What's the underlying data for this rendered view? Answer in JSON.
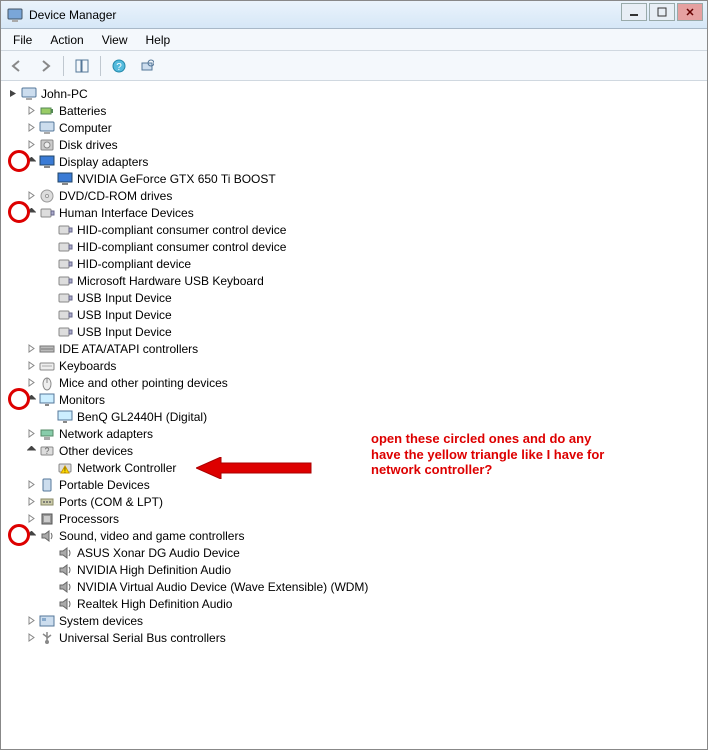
{
  "window": {
    "title": "Device Manager"
  },
  "menus": {
    "file": "File",
    "action": "Action",
    "view": "View",
    "help": "Help"
  },
  "root": {
    "name": "John-PC"
  },
  "tree": [
    {
      "label": "Batteries",
      "icon": "battery",
      "expand": "closed",
      "lv": 1
    },
    {
      "label": "Computer",
      "icon": "computer",
      "expand": "closed",
      "lv": 1
    },
    {
      "label": "Disk drives",
      "icon": "disk",
      "expand": "closed",
      "lv": 1
    },
    {
      "label": "Display adapters",
      "icon": "display",
      "expand": "open",
      "lv": 1,
      "circle": true
    },
    {
      "label": "NVIDIA GeForce GTX 650 Ti BOOST",
      "icon": "display",
      "expand": "none",
      "lv": 2
    },
    {
      "label": "DVD/CD-ROM drives",
      "icon": "dvd",
      "expand": "closed",
      "lv": 1
    },
    {
      "label": "Human Interface Devices",
      "icon": "hid",
      "expand": "open",
      "lv": 1,
      "circle": true
    },
    {
      "label": "HID-compliant consumer control device",
      "icon": "hid",
      "expand": "none",
      "lv": 2
    },
    {
      "label": "HID-compliant consumer control device",
      "icon": "hid",
      "expand": "none",
      "lv": 2
    },
    {
      "label": "HID-compliant device",
      "icon": "hid",
      "expand": "none",
      "lv": 2
    },
    {
      "label": "Microsoft Hardware USB Keyboard",
      "icon": "hid",
      "expand": "none",
      "lv": 2
    },
    {
      "label": "USB Input Device",
      "icon": "hid",
      "expand": "none",
      "lv": 2
    },
    {
      "label": "USB Input Device",
      "icon": "hid",
      "expand": "none",
      "lv": 2
    },
    {
      "label": "USB Input Device",
      "icon": "hid",
      "expand": "none",
      "lv": 2
    },
    {
      "label": "IDE ATA/ATAPI controllers",
      "icon": "ide",
      "expand": "closed",
      "lv": 1
    },
    {
      "label": "Keyboards",
      "icon": "keyboard",
      "expand": "closed",
      "lv": 1
    },
    {
      "label": "Mice and other pointing devices",
      "icon": "mouse",
      "expand": "closed",
      "lv": 1
    },
    {
      "label": "Monitors",
      "icon": "monitor",
      "expand": "open",
      "lv": 1,
      "circle": true
    },
    {
      "label": "BenQ GL2440H (Digital)",
      "icon": "monitor",
      "expand": "none",
      "lv": 2
    },
    {
      "label": "Network adapters",
      "icon": "network",
      "expand": "closed",
      "lv": 1
    },
    {
      "label": "Other devices",
      "icon": "other",
      "expand": "open",
      "lv": 1
    },
    {
      "label": "Network Controller",
      "icon": "warn",
      "expand": "none",
      "lv": 2,
      "arrowto": true
    },
    {
      "label": "Portable Devices",
      "icon": "portable",
      "expand": "closed",
      "lv": 1
    },
    {
      "label": "Ports (COM & LPT)",
      "icon": "ports",
      "expand": "closed",
      "lv": 1
    },
    {
      "label": "Processors",
      "icon": "cpu",
      "expand": "closed",
      "lv": 1
    },
    {
      "label": "Sound, video and game controllers",
      "icon": "sound",
      "expand": "open",
      "lv": 1,
      "circle": true
    },
    {
      "label": "ASUS Xonar DG Audio Device",
      "icon": "sound",
      "expand": "none",
      "lv": 2
    },
    {
      "label": "NVIDIA High Definition Audio",
      "icon": "sound",
      "expand": "none",
      "lv": 2
    },
    {
      "label": "NVIDIA Virtual Audio Device (Wave Extensible) (WDM)",
      "icon": "sound",
      "expand": "none",
      "lv": 2
    },
    {
      "label": "Realtek High Definition Audio",
      "icon": "sound",
      "expand": "none",
      "lv": 2
    },
    {
      "label": "System devices",
      "icon": "system",
      "expand": "closed",
      "lv": 1
    },
    {
      "label": "Universal Serial Bus controllers",
      "icon": "usb",
      "expand": "closed",
      "lv": 1
    }
  ],
  "annotation": {
    "text1": "open these circled ones  and do any",
    "text2": "have the yellow triangle like I have for",
    "text3": "network controller?"
  }
}
